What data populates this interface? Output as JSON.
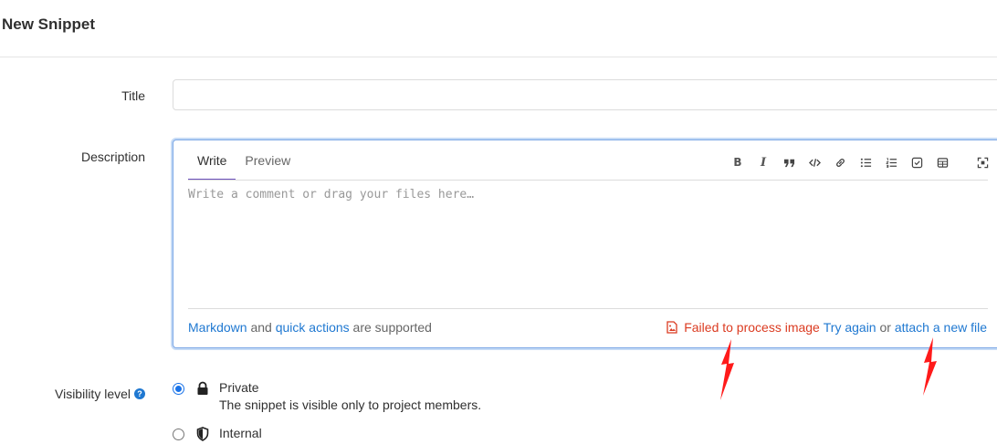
{
  "page": {
    "title": "New Snippet"
  },
  "form": {
    "title_label": "Title",
    "title_value": "",
    "description_label": "Description",
    "visibility_label": "Visibility level",
    "help_glyph": "?"
  },
  "editor": {
    "tabs": [
      {
        "label": "Write",
        "active": true
      },
      {
        "label": "Preview",
        "active": false
      }
    ],
    "toolbar": [
      "bold-icon",
      "italic-icon",
      "quote-icon",
      "code-icon",
      "link-icon",
      "bullet-list-icon",
      "numbered-list-icon",
      "task-list-icon",
      "table-icon",
      "fullscreen-icon"
    ],
    "bold_glyph": "B",
    "italic_glyph": "I",
    "placeholder": "Write a comment or drag your files here…",
    "footer": {
      "markdown_link": "Markdown",
      "and_text": " and ",
      "quick_actions_link": "quick actions",
      "supported_text": " are supported",
      "error_text": "Failed to process image",
      "try_again_link": "Try again",
      "or_text": " or ",
      "attach_link": "attach a new file"
    }
  },
  "visibility": {
    "options": [
      {
        "name": "Private",
        "description": "The snippet is visible only to project members.",
        "checked": true,
        "icon": "lock-icon"
      },
      {
        "name": "Internal",
        "description": "",
        "checked": false,
        "icon": "shield-icon"
      }
    ]
  },
  "colors": {
    "accent": "#1f78d1",
    "error": "#db3b21",
    "annotation_arrow": "#ff1a1a",
    "tab_underline": "#6b4fbb"
  }
}
